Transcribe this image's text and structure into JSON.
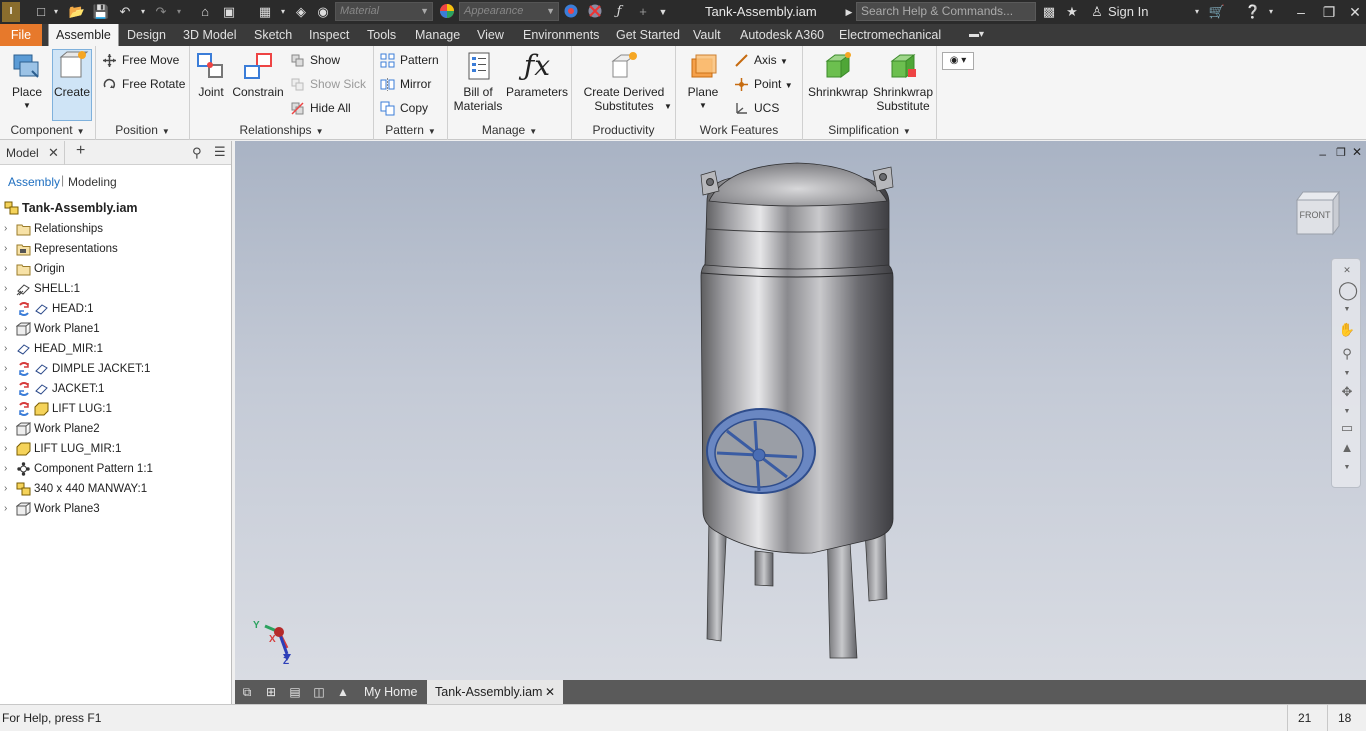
{
  "titlebar": {
    "material_placeholder": "Material",
    "appearance_placeholder": "Appearance",
    "document_title": "Tank-Assembly.iam",
    "search_placeholder": "Search Help & Commands...",
    "sign_in": "Sign In"
  },
  "tabs": [
    "File",
    "Assemble",
    "Design",
    "3D Model",
    "Sketch",
    "Inspect",
    "Tools",
    "Manage",
    "View",
    "Environments",
    "Get Started",
    "Vault",
    "Autodesk A360",
    "Electromechanical"
  ],
  "active_tab": "Assemble",
  "ribbon": {
    "component": {
      "title": "Component",
      "place": "Place",
      "create": "Create"
    },
    "position": {
      "title": "Position",
      "free_move": "Free Move",
      "free_rotate": "Free Rotate"
    },
    "relationships": {
      "title": "Relationships",
      "joint": "Joint",
      "constrain": "Constrain",
      "show": "Show",
      "show_sick": "Show Sick",
      "hide_all": "Hide All"
    },
    "pattern": {
      "title": "Pattern",
      "pattern": "Pattern",
      "mirror": "Mirror",
      "copy": "Copy"
    },
    "manage": {
      "title": "Manage",
      "bom_line1": "Bill of",
      "bom_line2": "Materials",
      "parameters": "Parameters"
    },
    "productivity": {
      "title": "Productivity",
      "derived_line1": "Create Derived",
      "derived_line2": "Substitutes"
    },
    "work_features": {
      "title": "Work Features",
      "plane": "Plane",
      "axis": "Axis",
      "point": "Point",
      "ucs": "UCS"
    },
    "simplification": {
      "title": "Simplification",
      "shrinkwrap": "Shrinkwrap",
      "sw_sub_line1": "Shrinkwrap",
      "sw_sub_line2": "Substitute"
    }
  },
  "browser": {
    "tab_label": "Model",
    "sub_assembly": "Assembly",
    "sub_modeling": "Modeling",
    "root": "Tank-Assembly.iam",
    "items": [
      {
        "label": "Relationships",
        "icon": "folder-icon"
      },
      {
        "label": "Representations",
        "icon": "representations-icon"
      },
      {
        "label": "Origin",
        "icon": "folder-icon"
      },
      {
        "label": "SHELL:1",
        "icon": "grounded-part-icon"
      },
      {
        "label": "HEAD:1",
        "icon": "part-icon"
      },
      {
        "label": "Work Plane1",
        "icon": "work-plane-icon"
      },
      {
        "label": "HEAD_MIR:1",
        "icon": "part-icon"
      },
      {
        "label": "DIMPLE JACKET:1",
        "icon": "part-icon"
      },
      {
        "label": "JACKET:1",
        "icon": "part-icon"
      },
      {
        "label": "LIFT LUG:1",
        "icon": "part-icon"
      },
      {
        "label": "Work Plane2",
        "icon": "work-plane-icon"
      },
      {
        "label": "LIFT LUG_MIR:1",
        "icon": "part-icon"
      },
      {
        "label": "Component Pattern 1:1",
        "icon": "pattern-icon"
      },
      {
        "label": "340 x 440 MANWAY:1",
        "icon": "assembly-icon"
      },
      {
        "label": "Work Plane3",
        "icon": "work-plane-icon"
      }
    ]
  },
  "viewcube": {
    "face_label": "FRONT"
  },
  "triad": {
    "x": "X",
    "y": "Y",
    "z": "Z"
  },
  "doc_tabs": {
    "home": "My Home",
    "doc": "Tank-Assembly.iam"
  },
  "status": {
    "help": "For Help, press F1",
    "count1": "21",
    "count2": "18"
  },
  "colors": {
    "file_tab": "#e7792b",
    "accent_blue": "#1f6fc0",
    "title_bg": "#2b2b2b"
  }
}
